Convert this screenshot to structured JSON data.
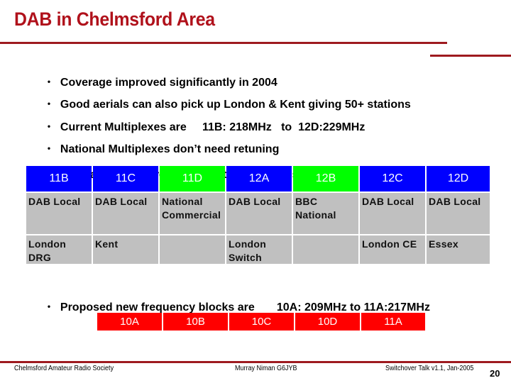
{
  "slide": {
    "title": "DAB in Chelmsford Area",
    "bullets": [
      {
        "text": "Coverage improved significantly in 2004"
      },
      {
        "text": "Good aerials can also pick up London & Kent giving 50+ stations"
      },
      {
        "text": "Current Multiplexes are     11B: 218MHz   to  12D:229MHz"
      },
      {
        "text": "National Multiplexes don’t need retuning",
        "sub": "- they are Single Frequency Networks - SFNs"
      }
    ],
    "multiplex_table": {
      "headers": [
        {
          "label": "11B",
          "color": "#0000ff"
        },
        {
          "label": "11C",
          "color": "#0000ff"
        },
        {
          "label": "11D",
          "color": "#00ff00"
        },
        {
          "label": "12A",
          "color": "#0000ff"
        },
        {
          "label": "12B",
          "color": "#00ff00"
        },
        {
          "label": "12C",
          "color": "#0000ff"
        },
        {
          "label": "12D",
          "color": "#0000ff"
        }
      ],
      "rows": [
        [
          "DAB Local",
          "DAB Local",
          "National\nCommercial",
          "DAB Local",
          "BBC\nNational",
          "DAB Local",
          "DAB Local"
        ],
        [
          "London\nDRG",
          "Kent",
          "",
          "London\nSwitch",
          "",
          "London CE",
          "Essex"
        ]
      ]
    },
    "proposed_bullet": "Proposed new frequency blocks are       10A: 209MHz to 11A:217MHz",
    "proposed_blocks": [
      "10A",
      "10B",
      "10C",
      "10D",
      "11A"
    ],
    "proposed_block_color": "#ff0000",
    "footer": {
      "left": "Chelmsford Amateur Radio Society",
      "center": "Murray Niman G6JYB",
      "right": "Switchover Talk v1.1, Jan-2005",
      "page_number": "20"
    },
    "accent_color": "#b0111b"
  }
}
